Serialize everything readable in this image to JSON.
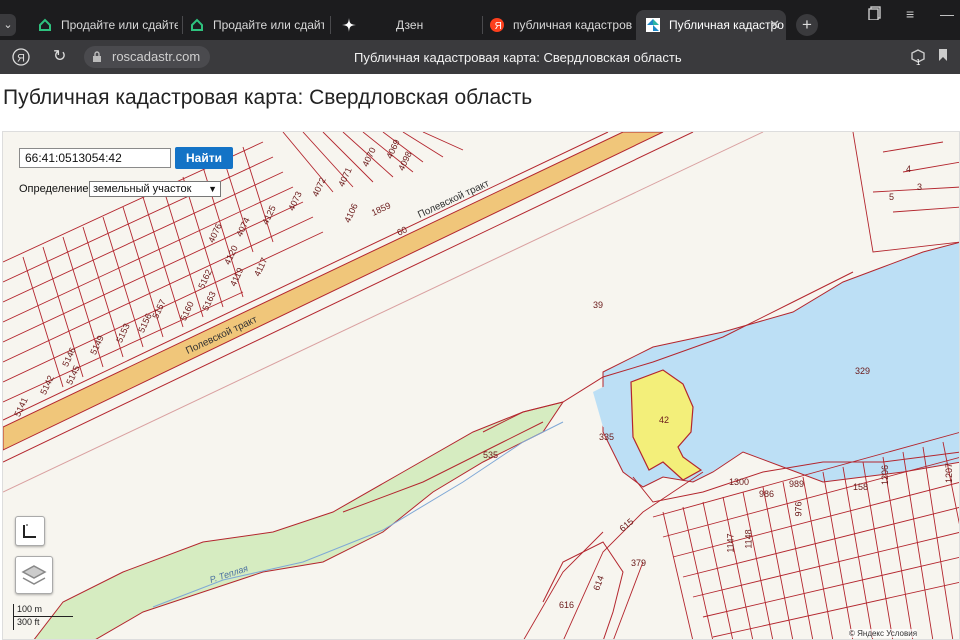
{
  "browser": {
    "tabs": [
      {
        "title": "Продайте или сдайте в",
        "icon": "green-house-icon"
      },
      {
        "title": "Продайте или сдайте в",
        "icon": "green-house-icon"
      },
      {
        "title": "Дзен",
        "icon": "dzen-star-icon"
      },
      {
        "title": "публичная кадастров",
        "icon": "yandex-icon"
      },
      {
        "title": "Публичная кадастро",
        "icon": "rosreestr-icon",
        "active": true
      }
    ],
    "url": "roscadastr.com",
    "page_caption": "Публичная кадастровая карта: Свердловская область",
    "extension_badge": "1"
  },
  "page": {
    "title": "Публичная кадастровая карта: Свердловская область"
  },
  "map": {
    "search": {
      "value": "66:41:0513054:42",
      "button": "Найти"
    },
    "definition": {
      "label": "Определение:",
      "selected": "земельный участок"
    },
    "scale": {
      "metric": "100 m",
      "imperial": "300 ft"
    },
    "attribution": "© Яндекс Условия",
    "road_labels": [
      "Полевской тракт",
      "Полевской тракт"
    ],
    "river_label": "Р. Теплая",
    "parcel_labels": [
      "39",
      "42",
      "335",
      "535",
      "329",
      "158",
      "1300",
      "986",
      "989",
      "379",
      "614",
      "616",
      "615",
      "60",
      "4",
      "5",
      "3",
      "4106",
      "1859",
      "4119",
      "4117",
      "4120",
      "4076",
      "4074",
      "4125",
      "4073",
      "4072",
      "4071",
      "4070",
      "4069",
      "4098",
      "5160",
      "5163",
      "5162",
      "5157",
      "5156",
      "5153",
      "5149",
      "5146",
      "5145",
      "5142",
      "5141",
      "1206",
      "1207",
      "976",
      "1147",
      "1148"
    ]
  },
  "colors": {
    "parcel_line": "#b3262e",
    "water": "#bcdff5",
    "selected_parcel": "#f3ef7a",
    "forest": "#d6ecc1",
    "road": "#f0c67a"
  }
}
